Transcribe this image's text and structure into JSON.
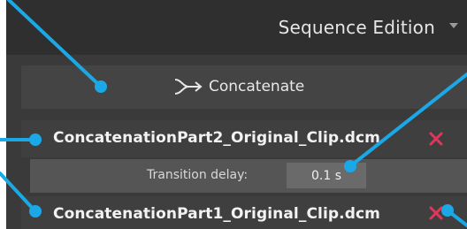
{
  "header": {
    "title": "Sequence Edition"
  },
  "concatenate": {
    "label": "Concatenate",
    "icon": "merge-arrow-icon"
  },
  "clips": [
    {
      "name": "ConcatenationPart2_Original_Clip.dcm",
      "remove_icon": "close-icon"
    },
    {
      "name": "ConcatenationPart1_Original_Clip.dcm",
      "remove_icon": "close-icon"
    }
  ],
  "transition": {
    "label": "Transition delay:",
    "value": "0.1 s"
  },
  "colors": {
    "callout": "#1aa8e6",
    "remove": "#e0365e",
    "panel": "#3a3a3a"
  }
}
